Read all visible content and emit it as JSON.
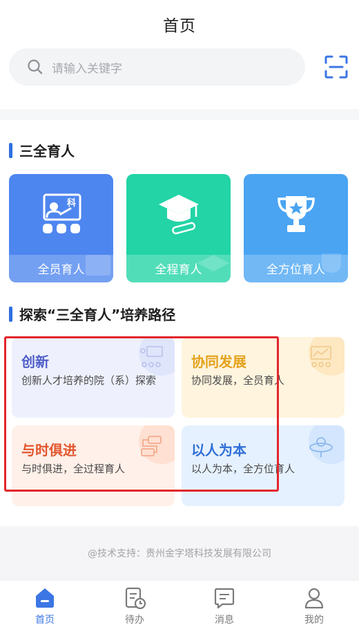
{
  "header": {
    "title": "首页"
  },
  "search": {
    "placeholder": "请输入关键字"
  },
  "section1": {
    "title": "三全育人",
    "tiles": [
      {
        "label": "全员育人",
        "color": "#4e86ef"
      },
      {
        "label": "全程育人",
        "color": "#22d4a6"
      },
      {
        "label": "全方位育人",
        "color": "#4aa4f2"
      }
    ],
    "blackboard_char": "科"
  },
  "section2": {
    "title": "探索“三全育人”培养路径",
    "cards": [
      {
        "title": "创新",
        "desc": "创新人才培养的院（系）探索",
        "title_color": "#4f5fc9",
        "bg": "#eef1fd"
      },
      {
        "title": "协同发展",
        "desc": "协同发展，全员育人",
        "title_color": "#e3a21b",
        "bg": "#fff4de"
      },
      {
        "title": "与时俱进",
        "desc": "与时俱进，全过程育人",
        "title_color": "#e2562e",
        "bg": "#fff0e9"
      },
      {
        "title": "以人为本",
        "desc": "以人为本，全方位育人",
        "title_color": "#2e6fd6",
        "bg": "#e6f1ff"
      }
    ]
  },
  "footer": {
    "support": "@技术支持：贵州金字塔科技发展有限公司"
  },
  "tabbar": {
    "items": [
      {
        "label": "首页",
        "icon": "home-icon",
        "active": true
      },
      {
        "label": "待办",
        "icon": "todo-icon",
        "active": false
      },
      {
        "label": "消息",
        "icon": "message-icon",
        "active": false
      },
      {
        "label": "我的",
        "icon": "profile-icon",
        "active": false
      }
    ],
    "active_color": "#3b76e4"
  }
}
